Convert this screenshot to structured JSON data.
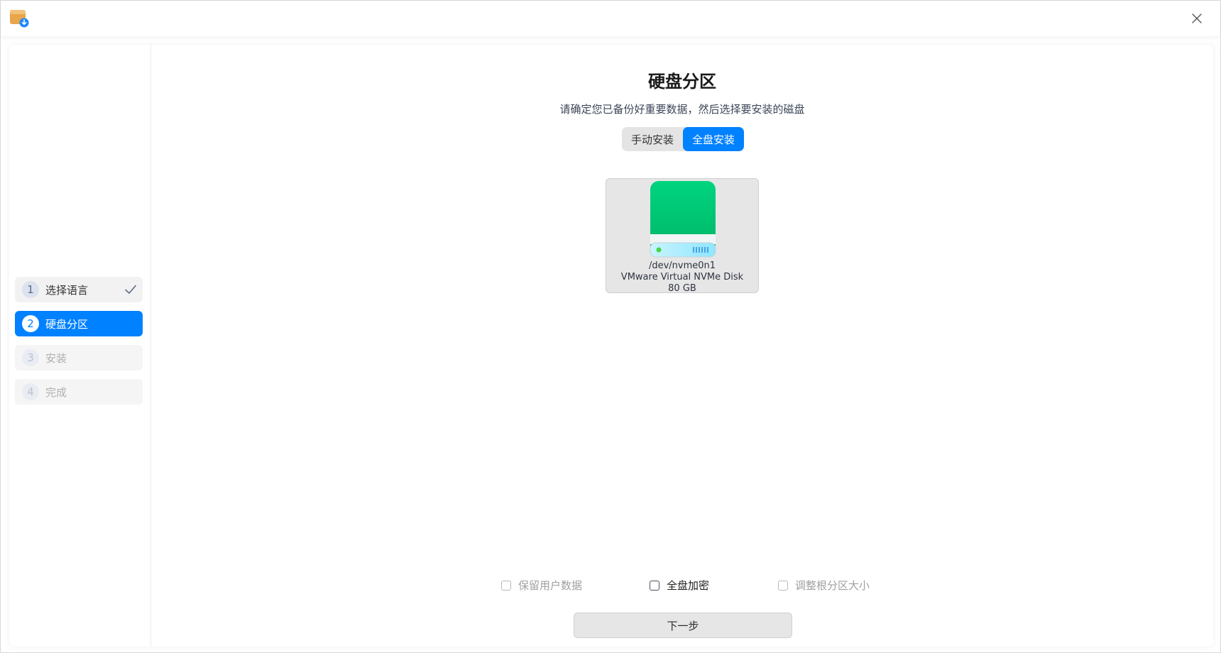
{
  "window": {
    "app_icon": "installer-icon",
    "close_icon": "close-icon"
  },
  "sidebar": {
    "steps": [
      {
        "number": "1",
        "label": "选择语言",
        "state": "done"
      },
      {
        "number": "2",
        "label": "硬盘分区",
        "state": "active"
      },
      {
        "number": "3",
        "label": "安装",
        "state": "pending"
      },
      {
        "number": "4",
        "label": "完成",
        "state": "pending"
      }
    ]
  },
  "main": {
    "title": "硬盘分区",
    "subtitle": "请确定您已备份好重要数据，然后选择要安装的磁盘",
    "modes": [
      {
        "label": "手动安装",
        "selected": false
      },
      {
        "label": "全盘安装",
        "selected": true
      }
    ],
    "disk": {
      "icon": "hard-drive-icon",
      "device": "/dev/nvme0n1",
      "model": "VMware Virtual NVMe Disk",
      "size": "80 GB"
    },
    "options": [
      {
        "label": "保留用户数据",
        "checked": false,
        "enabled": false
      },
      {
        "label": "全盘加密",
        "checked": false,
        "enabled": true
      },
      {
        "label": "调整根分区大小",
        "checked": false,
        "enabled": false
      }
    ],
    "next_label": "下一步"
  },
  "colors": {
    "accent": "#0081ff",
    "disk_green": "#00c472"
  }
}
